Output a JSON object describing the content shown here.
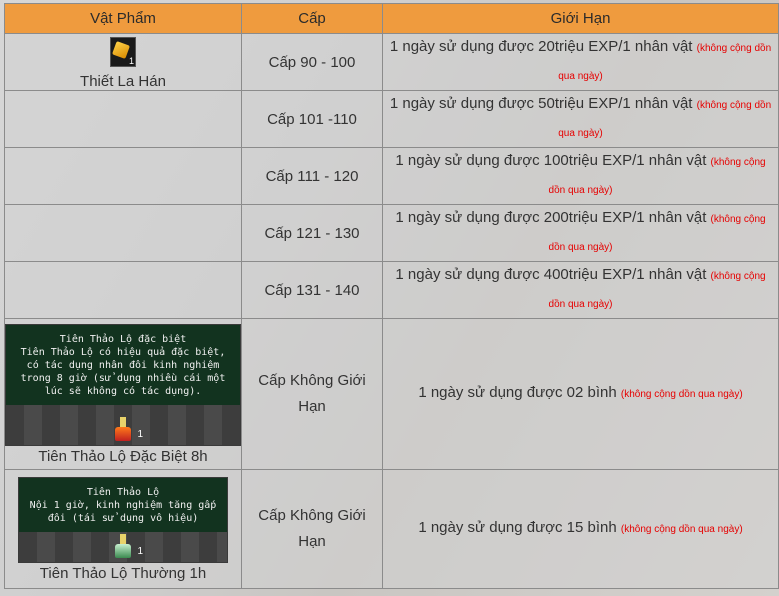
{
  "headers": [
    "Vật Phẩm",
    "Cấp",
    "Giới Hạn"
  ],
  "rows": [
    {
      "item": "Thiết La Hán",
      "icon_qty": "1",
      "level": "Cấp 90 - 100",
      "limit": "1 ngày sử dụng được 20triệu EXP/1 nhân vật",
      "note": "(không cộng dồn qua ngày)"
    },
    {
      "item": "",
      "level": "Cấp 101 -110",
      "limit": "1 ngày sử dụng được 50triệu EXP/1 nhân vật",
      "note": "(không cộng dồn qua ngày)"
    },
    {
      "item": "",
      "level": "Cấp 111 - 120",
      "limit": "1 ngày sử dụng được 100triệu EXP/1 nhân vật",
      "note": "(không cộng dồn qua ngày)"
    },
    {
      "item": "",
      "level": "Cấp 121 - 130",
      "limit": "1 ngày sử dụng được 200triệu EXP/1 nhân vật",
      "note": "(không cộng dồn qua ngày)"
    },
    {
      "item": "",
      "level": "Cấp 131 - 140",
      "limit": "1 ngày sử dụng được 400triệu EXP/1 nhân vật",
      "note": "(không cộng dồn qua ngày)"
    },
    {
      "item": "Tiên Thảo Lộ Đặc Biệt 8h",
      "tooltip_title": "Tiên Thảo Lộ đặc biệt",
      "tooltip_desc": "Tiên Thảo Lộ có hiệu quả đặc biệt, có tác dụng nhân đôi kinh nghiệm trong 8 giờ (sử dụng nhiều cái một lúc sẽ không có tác dụng).",
      "icon_qty": "1",
      "level": "Cấp Không Giới Hạn",
      "limit": "1 ngày sử dụng được 02 bình",
      "note": "(không cộng dồn qua ngày)"
    },
    {
      "item": "Tiên Thảo Lộ Thường 1h",
      "tooltip_title": "Tiên Thảo Lộ",
      "tooltip_desc": "Nội 1 giờ, kinh nghiệm tăng gấp đôi (tái sử dụng vô hiệu)",
      "icon_qty": "1",
      "level": "Cấp Không Giới Hạn",
      "limit": "1 ngày sử dụng được 15 bình",
      "note": "(không cộng dồn qua ngày)"
    }
  ],
  "colors": {
    "header_bg": "#ef9b3e",
    "note": "#e60000",
    "tooltip_bg": "#12331f"
  },
  "icons": [
    "gold-gem-icon",
    "red-flask-icon",
    "green-flask-icon"
  ]
}
